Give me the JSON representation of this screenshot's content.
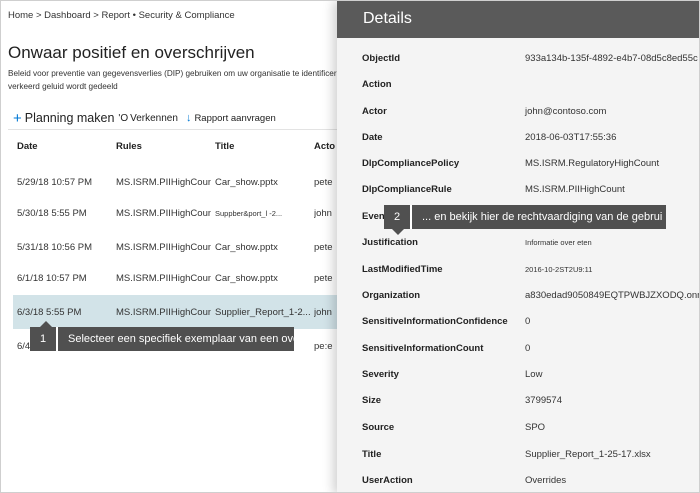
{
  "breadcrumb": "Home > Dashboard > Report • Security & Compliance",
  "page_title": "Onwaar positief en overschrijven",
  "page_description": "Beleid voor preventie van gegevensverlies (DIP) gebruiken om uw organisatie te identificeren en te beveiligen de met verkeerd geluid wordt gedeeld",
  "toolbar": {
    "plan_icon": "+",
    "plan_label": "Planning maken",
    "explore_icon": "'O",
    "explore_label": "Verkennen",
    "report_icon": "↓",
    "report_label": "Rapport aanvragen"
  },
  "table": {
    "columns": [
      "Date",
      "Rules",
      "Title",
      "Acto"
    ],
    "rows": [
      {
        "date": "5/29/18 10:57 PM",
        "rules": "MS.ISRM.PIIHighCount",
        "title": "Car_show.pptx",
        "actor": "pete"
      },
      {
        "date": "5/30/18 5:55 PM",
        "rules": "MS.ISRM.PIIHighCount",
        "title": "Suppber&port_l      -2...",
        "actor": "john"
      },
      {
        "date": "5/31/18 10:56 PM",
        "rules": "MS.ISRM.PIIHighCount",
        "title": "Car_show.pptx",
        "actor": "pete"
      },
      {
        "date": "6/1/18 10:57 PM",
        "rules": "MS.ISRM.PIIHighCount",
        "title": "Car_show.pptx",
        "actor": "pete"
      },
      {
        "date": "6/3/18 5:55 PM",
        "rules": "MS.ISRM.PIIHighCount",
        "title": "Supplier_Report_1-2...",
        "actor": "john"
      },
      {
        "date": "6/4",
        "rules": "",
        "title": "",
        "actor": "pe:e"
      }
    ]
  },
  "callouts": {
    "one": {
      "number": "1",
      "text": "Selecteer een specifiek exemplaar van een ove"
    },
    "two": {
      "number": "2",
      "text": "... en bekijk hier de rechtvaardiging van de gebrui"
    }
  },
  "details": {
    "title": "Details",
    "objectid_key": "ObjectId",
    "objectid_val": "933a134b-135f-4892-e4b7-08d5c8ed55c",
    "action_key": "Action",
    "action_val": "",
    "actor_key": "Actor",
    "actor_val": "john@contoso.com",
    "date_key": "Date",
    "date_val": "2018-06-03T17:55:36",
    "policy_key": "DlpCompliancePolicy",
    "policy_val": "MS.ISRM.RegulatoryHighCount",
    "rule_key": "DlpComplianceRule",
    "rule_val": "MS.ISRM.PIIHighCount",
    "event_key": "Even",
    "event_val": "",
    "justification_key": "Justification",
    "justification_val": "Informatie over eten",
    "lastmod_key": "LastModifiedTime",
    "lastmod_val": "2016-10-2ST2U9:11",
    "org_key": "Organization",
    "org_val": "a830edad9050849EQTPWBJZXODQ.onmicr",
    "conf_key": "SensitiveInformationConfidence",
    "conf_val": "0",
    "count_key": "SensitiveInformationCount",
    "count_val": "0",
    "severity_key": "Severity",
    "severity_val": "Low",
    "size_key": "Size",
    "size_val": "3799574",
    "source_key": "Source",
    "source_val": "SPO",
    "title_key": "Title",
    "title_val": "Supplier_Report_1-25-17.xlsx",
    "useraction_key": "UserAction",
    "useraction_val": "Overrides"
  },
  "colors": {
    "panel_header": "#5a5a5a",
    "callout": "#505050",
    "selected_row": "#d2e3e8",
    "accent": "#0078d4"
  }
}
